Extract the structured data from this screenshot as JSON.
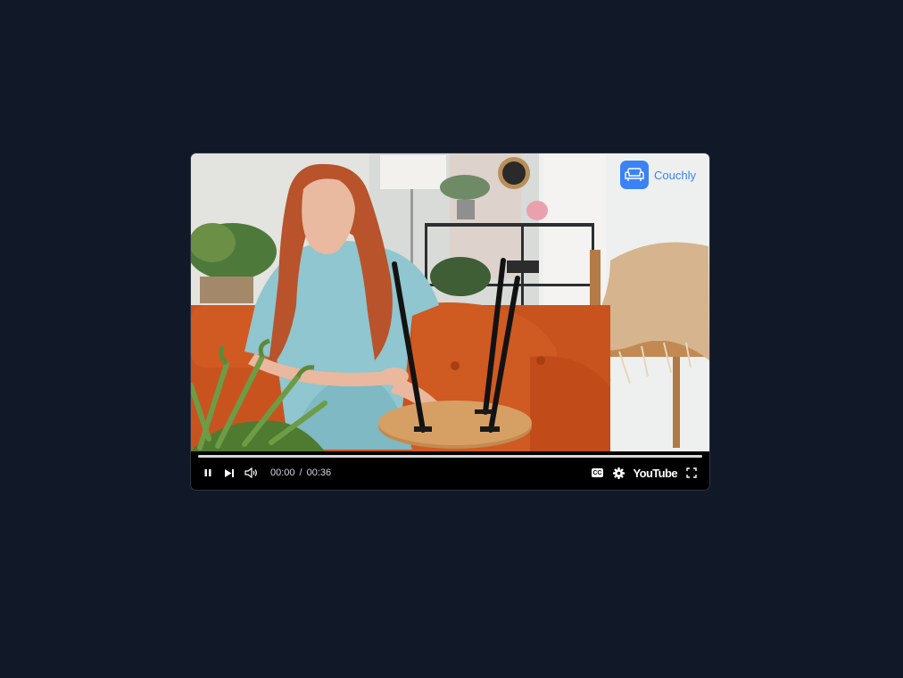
{
  "brand": {
    "name": "Couchly",
    "color": "#3b82f6",
    "icon": "sofa-icon"
  },
  "video": {
    "scene": "video-frame",
    "progress": 0.0
  },
  "controls": {
    "current_time": "00:00",
    "separator": "/",
    "duration": "00:36",
    "cc_label": "CC",
    "platform_label": "YouTube",
    "icons": [
      "pause-icon",
      "next-icon",
      "volume-icon",
      "captions-icon",
      "settings-gear-icon",
      "fullscreen-icon"
    ]
  },
  "colors": {
    "page_background": "#111827",
    "control_bar": "#000000"
  }
}
